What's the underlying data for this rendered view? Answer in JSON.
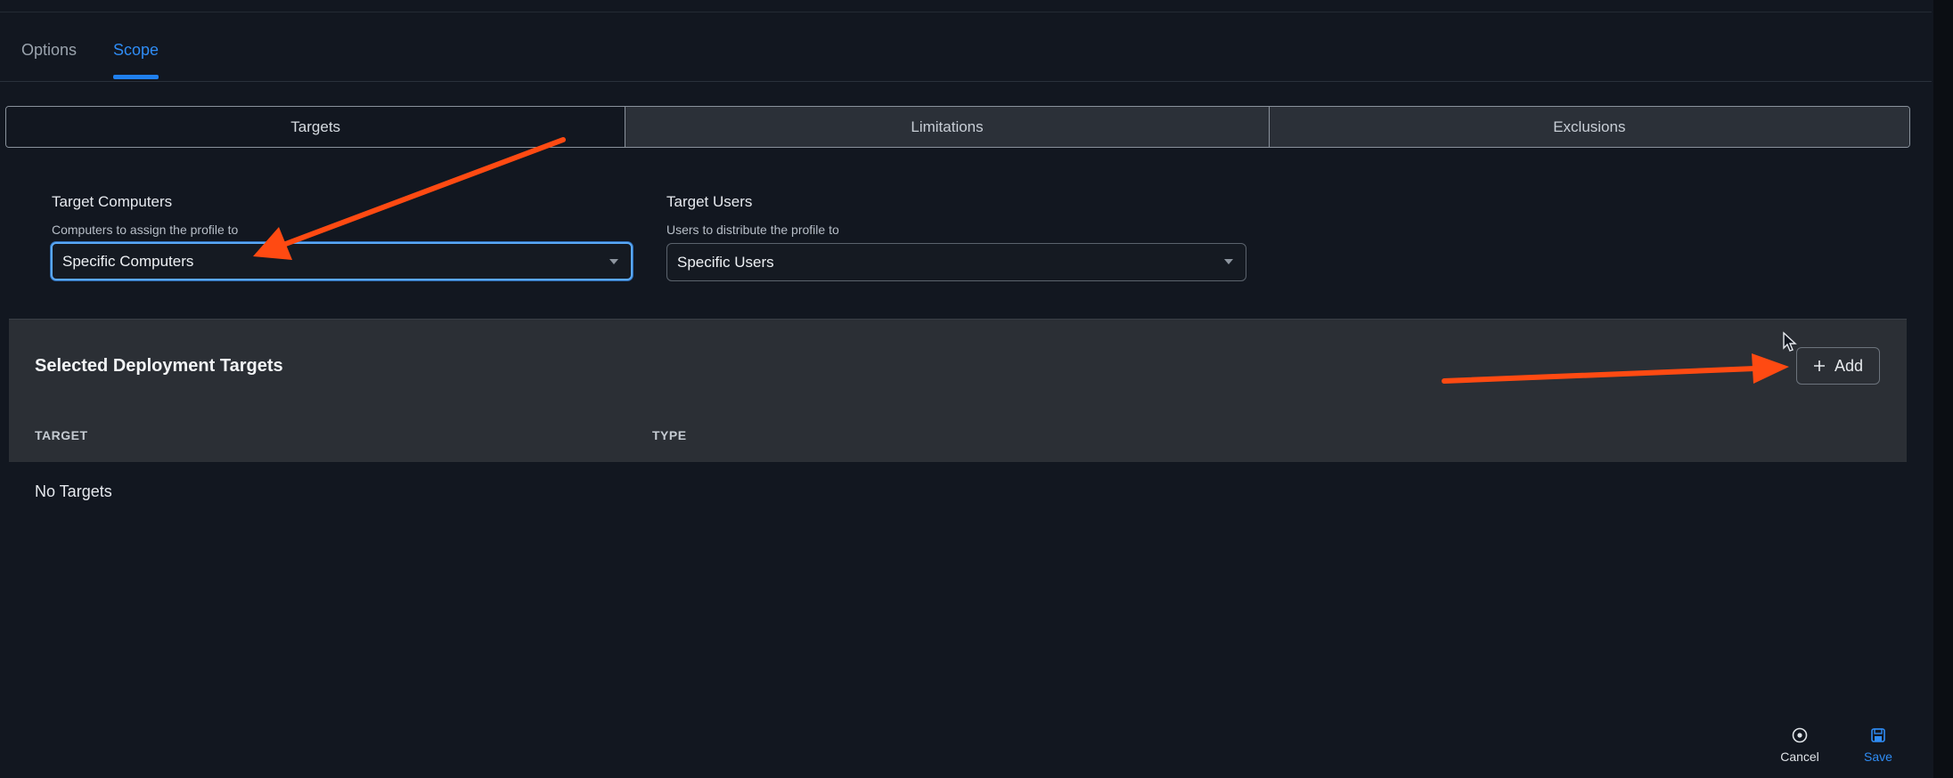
{
  "tabs": [
    {
      "label": "Options",
      "active": false
    },
    {
      "label": "Scope",
      "active": true
    }
  ],
  "segments": [
    "Targets",
    "Limitations",
    "Exclusions"
  ],
  "active_segment": "Targets",
  "target_computers": {
    "title": "Target Computers",
    "subtitle": "Computers to assign the profile to",
    "value": "Specific Computers"
  },
  "target_users": {
    "title": "Target Users",
    "subtitle": "Users to distribute the profile to",
    "value": "Specific Users"
  },
  "deployment": {
    "title": "Selected Deployment Targets",
    "add_label": "Add",
    "columns": [
      "TARGET",
      "TYPE"
    ],
    "empty_text": "No Targets"
  },
  "footer": {
    "cancel_label": "Cancel",
    "save_label": "Save"
  },
  "colors": {
    "accent": "#2f8cf4",
    "annotation_arrow": "#ff4a12",
    "background": "#121720"
  },
  "icons": [
    "plus-icon",
    "chevron-down-icon",
    "cancel-icon",
    "save-icon",
    "mouse-cursor-icon"
  ]
}
